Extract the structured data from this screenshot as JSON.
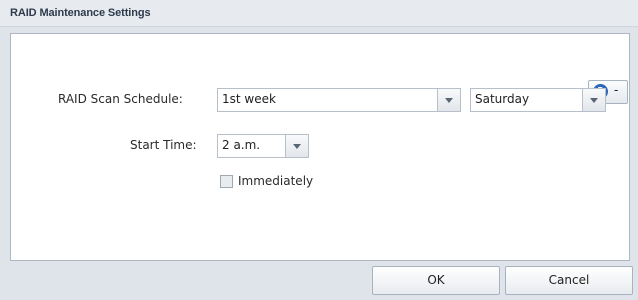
{
  "dialog": {
    "title": "RAID Maintenance Settings"
  },
  "help": {
    "icon": "?",
    "menu_arrow": "-"
  },
  "form": {
    "scan_schedule_label": "RAID Scan Schedule:",
    "week_value": "1st week",
    "day_value": "Saturday",
    "start_time_label": "Start Time:",
    "time_value": "2 a.m.",
    "immediately_label": "Immediately",
    "immediately_checked": false
  },
  "footer": {
    "ok_label": "OK",
    "cancel_label": "Cancel"
  }
}
